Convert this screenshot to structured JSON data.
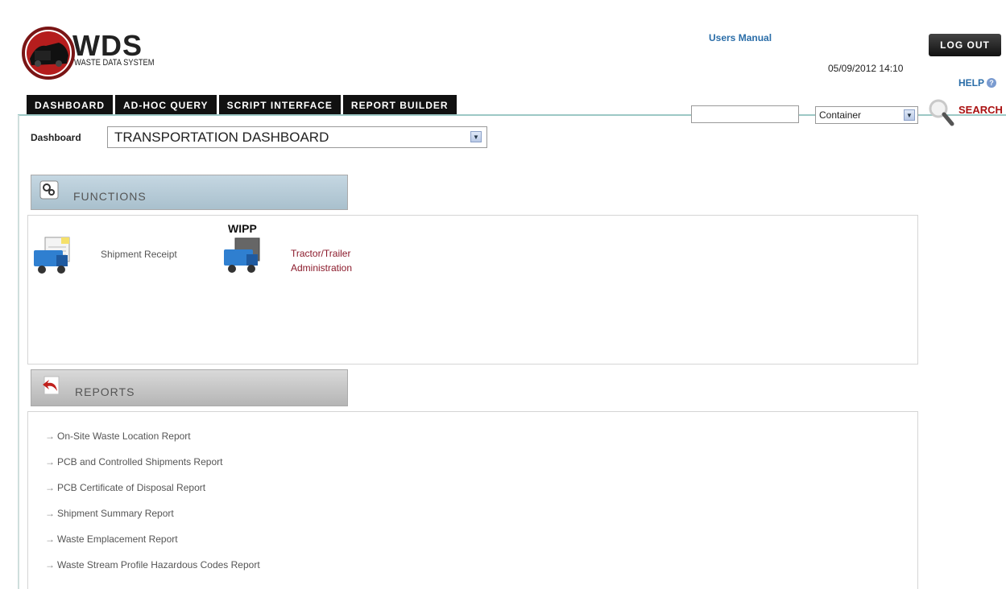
{
  "logo": {
    "title": "WDS",
    "subtitle": "WASTE DATA SYSTEM"
  },
  "header": {
    "users_manual": "Users Manual",
    "datetime": "05/09/2012 14:10",
    "logout": "LOG OUT",
    "help": "HELP"
  },
  "tabs": [
    "DASHBOARD",
    "AD-HOC QUERY",
    "SCRIPT INTERFACE",
    "REPORT BUILDER"
  ],
  "search": {
    "value": "",
    "type_selected": "Container",
    "label": "SEARCH"
  },
  "dashboard": {
    "label": "Dashboard",
    "selected": "TRANSPORTATION DASHBOARD"
  },
  "functions": {
    "title": "FUNCTIONS",
    "items": [
      {
        "label": "Shipment Receipt"
      },
      {
        "label_line1": "Tractor/Trailer",
        "label_line2": "Administration",
        "badge": "WIPP"
      }
    ]
  },
  "reports": {
    "title": "REPORTS",
    "items": [
      "On-Site Waste Location Report",
      "PCB and Controlled Shipments Report",
      "PCB Certificate of Disposal Report",
      "Shipment Summary Report",
      "Waste Emplacement Report",
      "Waste Stream Profile Hazardous Codes Report"
    ]
  },
  "colors": {
    "tab_bg": "#111111",
    "link_blue": "#2a6da8",
    "search_red": "#aa1111",
    "function_link": "#8b1a2b"
  }
}
